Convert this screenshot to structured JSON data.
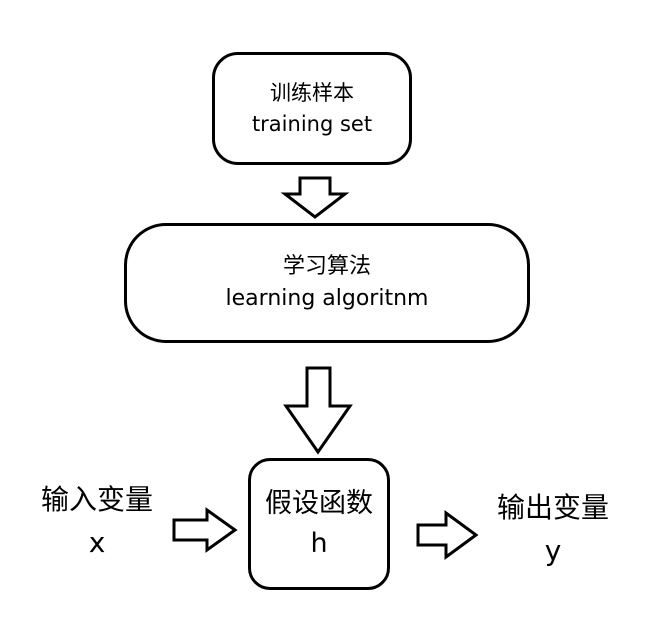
{
  "training_set": {
    "zh": "训练样本",
    "en": "training set"
  },
  "learning_algorithm": {
    "zh": "学习算法",
    "en": "learning algoritnm"
  },
  "hypothesis": {
    "zh": "假设函数",
    "symbol": "h"
  },
  "input": {
    "zh": "输入变量",
    "symbol": "x"
  },
  "output": {
    "zh": "输出变量",
    "symbol": "y"
  }
}
